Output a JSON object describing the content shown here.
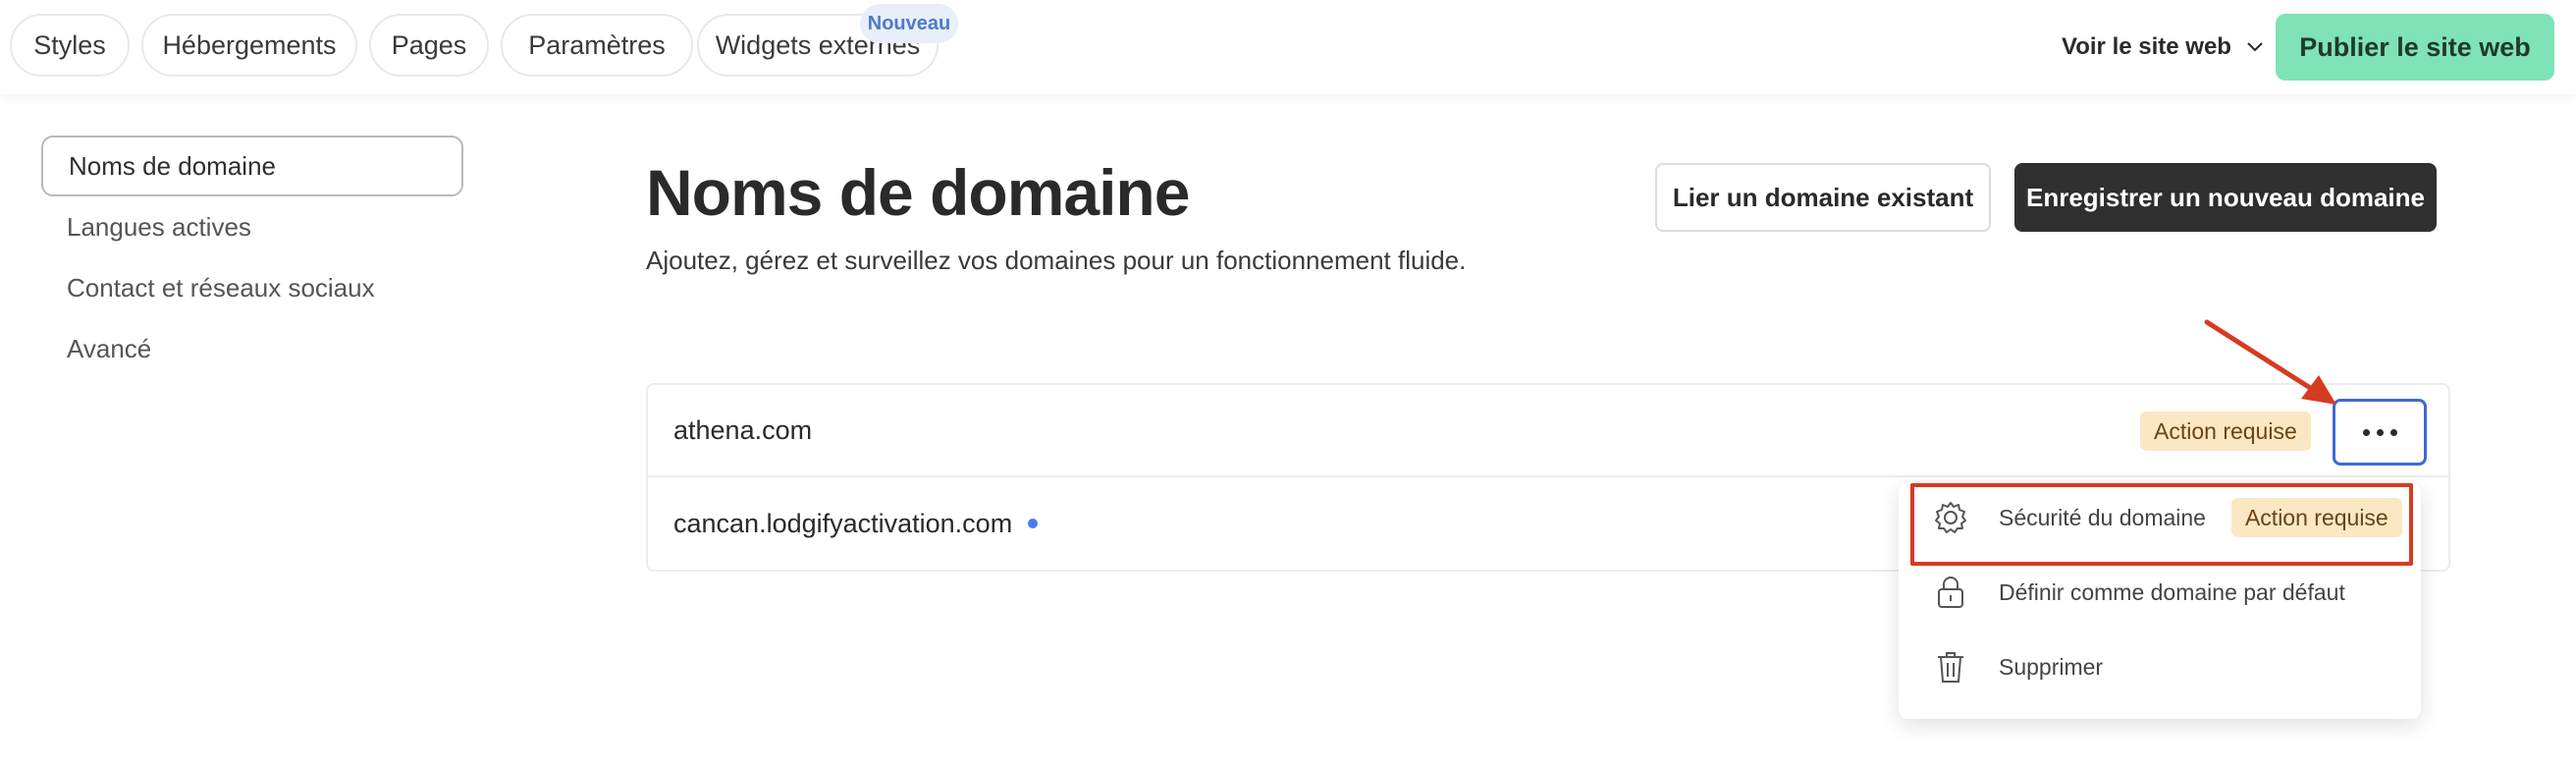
{
  "topbar": {
    "tabs": [
      {
        "label": "Styles"
      },
      {
        "label": "Hébergements"
      },
      {
        "label": "Pages"
      },
      {
        "label": "Paramètres"
      },
      {
        "label": "Widgets externes"
      }
    ],
    "new_badge": "Nouveau",
    "view_site": "Voir le site web",
    "publish": "Publier le site web"
  },
  "sidebar": {
    "items": [
      {
        "label": "Noms de domaine",
        "active": true
      },
      {
        "label": "Langues actives"
      },
      {
        "label": "Contact et réseaux sociaux"
      },
      {
        "label": "Avancé"
      }
    ]
  },
  "main": {
    "title": "Noms de domaine",
    "subtitle": "Ajoutez, gérez et surveillez vos domaines pour un fonctionnement fluide.",
    "link_existing": "Lier un domaine existant",
    "register_new": "Enregistrer un nouveau domaine",
    "domains": [
      {
        "name": "athena.com",
        "status": "Action requise"
      },
      {
        "name": "cancan.lodgifyactivation.com",
        "indicator": "blue-dot"
      }
    ],
    "menu": {
      "items": [
        {
          "label": "Sécurité du domaine",
          "icon": "gear-icon",
          "badge": "Action requise"
        },
        {
          "label": "Définir comme domaine par défaut",
          "icon": "lock-icon"
        },
        {
          "label": "Supprimer",
          "icon": "trash-icon"
        }
      ]
    }
  },
  "colors": {
    "accent": "#3f69d2",
    "publish_bg": "#7fe3b7",
    "badge_bg": "#fbe7c4",
    "annotation": "#d63b22"
  }
}
